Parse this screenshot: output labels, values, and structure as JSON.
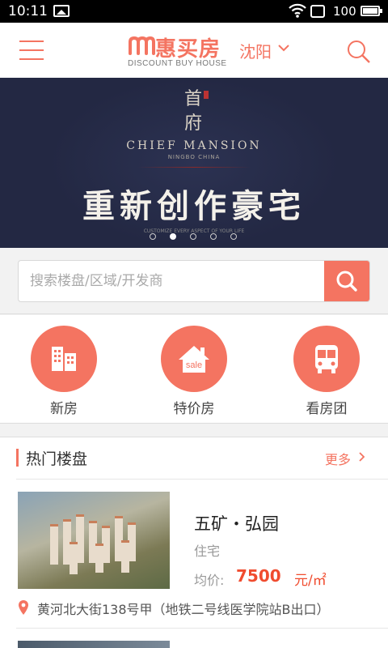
{
  "status_bar": {
    "time": "10:11",
    "battery_text": "100",
    "icons": [
      "image-icon",
      "wifi-icon",
      "sim-icon",
      "battery-icon"
    ]
  },
  "header": {
    "logo_cn": "惠买房",
    "logo_en": "DISCOUNT BUY HOUSE",
    "city": "沈阳",
    "icons": [
      "menu-icon",
      "chevron-down-icon",
      "search-icon"
    ]
  },
  "banner": {
    "seal_text": "首府",
    "brand": "CHIEF MANSION",
    "subbrand": "NINGBO CHINA",
    "slogan": "重新创作豪宅",
    "small_text": "CUSTOMIZE EVERY ASPECT OF YOUR LIFE",
    "dot_count": 5,
    "active_dot": 2
  },
  "search": {
    "placeholder": "搜索楼盘/区域/开发商",
    "value": ""
  },
  "shortcuts": [
    {
      "label": "新房",
      "icon": "buildings-icon"
    },
    {
      "label": "特价房",
      "icon": "sale-house-icon"
    },
    {
      "label": "看房团",
      "icon": "bus-icon"
    }
  ],
  "hot_section": {
    "title": "热门楼盘",
    "more": "更多"
  },
  "listings": [
    {
      "name": "五矿・弘园",
      "type": "住宅",
      "price_label": "均价:",
      "price": "7500",
      "unit": "元/㎡",
      "address": "黄河北大街138号甲（地铁二号线医学院站B出口）"
    }
  ],
  "colors": {
    "accent": "#f47461",
    "price": "#f04c2f",
    "banner_bg": "#232843"
  }
}
